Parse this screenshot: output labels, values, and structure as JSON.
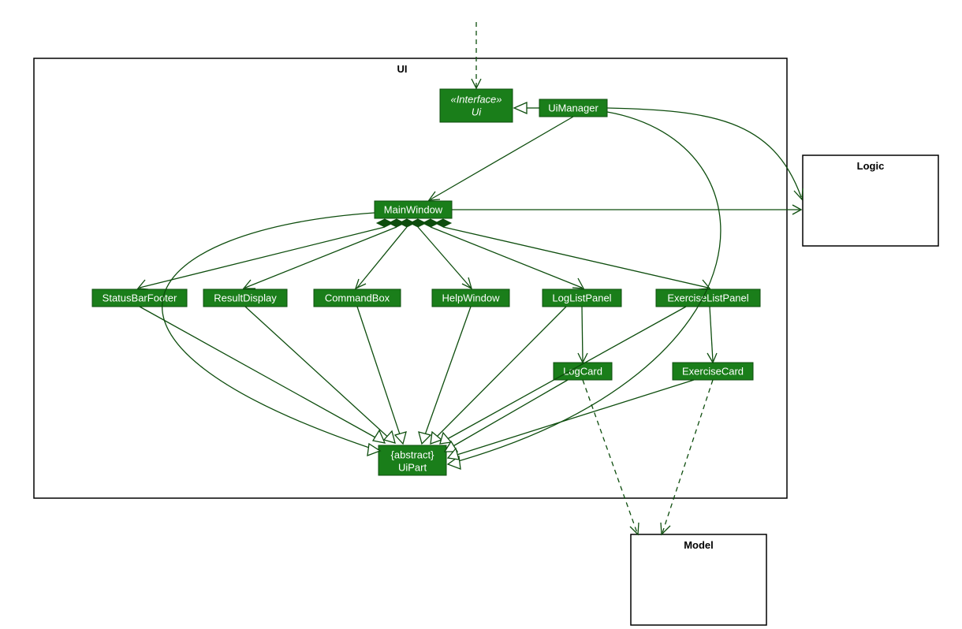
{
  "packages": {
    "ui": "UI",
    "logic": "Logic",
    "model": "Model"
  },
  "classes": {
    "uiInterface": {
      "stereotype": "«Interface»",
      "name": "Ui"
    },
    "uiManager": "UiManager",
    "mainWindow": "MainWindow",
    "statusBarFooter": "StatusBarFooter",
    "resultDisplay": "ResultDisplay",
    "commandBox": "CommandBox",
    "helpWindow": "HelpWindow",
    "logListPanel": "LogListPanel",
    "exerciseListPanel": "ExerciseListPanel",
    "logCard": "LogCard",
    "exerciseCard": "ExerciseCard",
    "uiPart": {
      "stereotype": "{abstract}",
      "name": "UiPart"
    }
  },
  "chart_data": {
    "type": "uml-class-diagram",
    "packages": [
      {
        "name": "UI",
        "contains": [
          "Ui",
          "UiManager",
          "MainWindow",
          "StatusBarFooter",
          "ResultDisplay",
          "CommandBox",
          "HelpWindow",
          "LogListPanel",
          "ExerciseListPanel",
          "LogCard",
          "ExerciseCard",
          "UiPart"
        ]
      },
      {
        "name": "Logic",
        "contains": []
      },
      {
        "name": "Model",
        "contains": []
      }
    ],
    "classes": [
      {
        "name": "Ui",
        "stereotype": "«Interface»"
      },
      {
        "name": "UiManager"
      },
      {
        "name": "MainWindow"
      },
      {
        "name": "StatusBarFooter"
      },
      {
        "name": "ResultDisplay"
      },
      {
        "name": "CommandBox"
      },
      {
        "name": "HelpWindow"
      },
      {
        "name": "LogListPanel"
      },
      {
        "name": "ExerciseListPanel"
      },
      {
        "name": "LogCard"
      },
      {
        "name": "ExerciseCard"
      },
      {
        "name": "UiPart",
        "stereotype": "{abstract}"
      }
    ],
    "relationships": [
      {
        "from": "external",
        "to": "Ui",
        "type": "dependency"
      },
      {
        "from": "UiManager",
        "to": "Ui",
        "type": "realization"
      },
      {
        "from": "UiManager",
        "to": "MainWindow",
        "type": "association"
      },
      {
        "from": "UiManager",
        "to": "Logic",
        "type": "association"
      },
      {
        "from": "MainWindow",
        "to": "Logic",
        "type": "association"
      },
      {
        "from": "MainWindow",
        "to": "StatusBarFooter",
        "type": "composition"
      },
      {
        "from": "MainWindow",
        "to": "ResultDisplay",
        "type": "composition"
      },
      {
        "from": "MainWindow",
        "to": "CommandBox",
        "type": "composition"
      },
      {
        "from": "MainWindow",
        "to": "HelpWindow",
        "type": "composition"
      },
      {
        "from": "MainWindow",
        "to": "LogListPanel",
        "type": "composition"
      },
      {
        "from": "MainWindow",
        "to": "ExerciseListPanel",
        "type": "composition"
      },
      {
        "from": "LogListPanel",
        "to": "LogCard",
        "type": "association"
      },
      {
        "from": "ExerciseListPanel",
        "to": "ExerciseCard",
        "type": "association"
      },
      {
        "from": "MainWindow",
        "to": "UiPart",
        "type": "generalization"
      },
      {
        "from": "StatusBarFooter",
        "to": "UiPart",
        "type": "generalization"
      },
      {
        "from": "ResultDisplay",
        "to": "UiPart",
        "type": "generalization"
      },
      {
        "from": "CommandBox",
        "to": "UiPart",
        "type": "generalization"
      },
      {
        "from": "HelpWindow",
        "to": "UiPart",
        "type": "generalization"
      },
      {
        "from": "LogListPanel",
        "to": "UiPart",
        "type": "generalization"
      },
      {
        "from": "ExerciseListPanel",
        "to": "UiPart",
        "type": "generalization"
      },
      {
        "from": "LogCard",
        "to": "UiPart",
        "type": "generalization"
      },
      {
        "from": "ExerciseCard",
        "to": "UiPart",
        "type": "generalization"
      },
      {
        "from": "UiManager",
        "to": "UiPart",
        "type": "generalization"
      },
      {
        "from": "LogCard",
        "to": "Model",
        "type": "dependency"
      },
      {
        "from": "ExerciseCard",
        "to": "Model",
        "type": "dependency"
      }
    ]
  }
}
